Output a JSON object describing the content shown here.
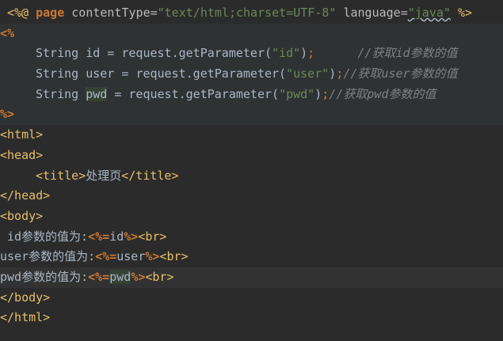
{
  "lines": [
    {
      "directive_open": "<%@",
      "directive_kw": "page",
      "attr1": "contentType=",
      "val1": "\"text/html;charset=UTF-8\"",
      "attr2": "language=",
      "val2": "\"java\"",
      "directive_close": "%>"
    },
    {
      "text": "<%"
    },
    {
      "decl": "String id = request.getParameter(",
      "arg": "\"id\"",
      "close": ")",
      "semi": ";",
      "comment": "//获取id参数的值"
    },
    {
      "decl": "String user = request.getParameter(",
      "arg": "\"user\"",
      "close": ")",
      "semi": ";",
      "comment": "//获取user参数的值"
    },
    {
      "decl_a": "String ",
      "decl_var": "pwd",
      "decl_b": " = request.getParameter(",
      "arg": "\"pwd\"",
      "close": ")",
      "semi": ";",
      "comment": "//获取pwd参数的值"
    },
    {
      "text": "%>"
    },
    {
      "text": "<html>"
    },
    {
      "text": "<head>"
    },
    {
      "open": "<title>",
      "content": "处理页",
      "close": "</title>"
    },
    {
      "text": "</head>"
    },
    {
      "text": "<body>"
    },
    {
      "label": "id参数的值为:",
      "expr_open": "<%=",
      "expr": "id",
      "expr_close": "%>",
      "br": "<br>"
    },
    {
      "label": "user参数的值为:",
      "expr_open": "<%=",
      "expr": "user",
      "expr_close": "%>",
      "br": "<br>"
    },
    {
      "label": "pwd参数的值为:",
      "expr_open": "<%=",
      "expr": "pwd",
      "expr_close": "%>",
      "br": "<br>"
    },
    {
      "text": "</body>"
    },
    {
      "text": "</html>"
    }
  ]
}
